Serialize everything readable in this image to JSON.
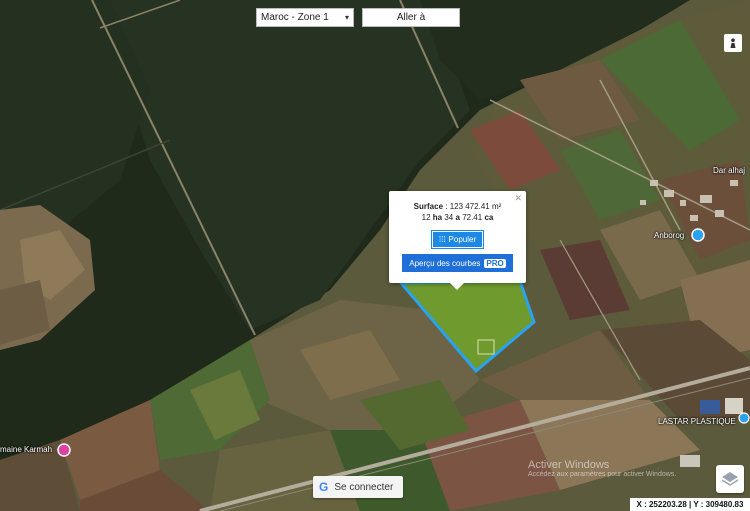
{
  "toolbar": {
    "zone_select_value": "Maroc - Zone 1",
    "goto_label": "Aller à"
  },
  "popup": {
    "surface_label": "Surface",
    "surface_value": ": 123 472.41 m²",
    "ha_value": "12",
    "ha_unit": "ha",
    "a_value": "34",
    "a_unit": "a",
    "ca_value": "72.41",
    "ca_unit": "ca",
    "populer_label": "Populer",
    "courbes_label": "Aperçu des courbes",
    "pro_badge": "PRO"
  },
  "places": {
    "dar_alhaj": "Dar alhaj",
    "anboroq": "Anborog",
    "domaine_karmah": "maine Karmah",
    "lastar": "LASTAR PLASTIQUE"
  },
  "auth": {
    "connect_label": "Se connecter"
  },
  "coords_text": "X : 252203.28 | Y : 309480.83",
  "watermark": {
    "line1": "Activer Windows",
    "line2": "Accédez aux paramètres pour activer Windows."
  },
  "colors": {
    "parcel_outline": "#29a3ee",
    "parcel_fill": "#6d8f2e",
    "button_blue": "#1e88e5"
  }
}
